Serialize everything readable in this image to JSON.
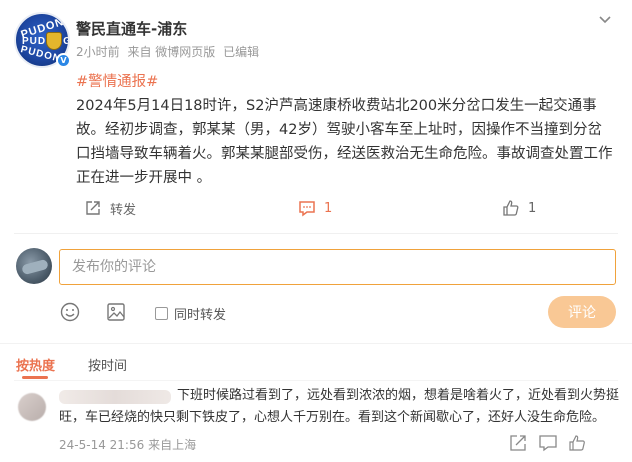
{
  "post": {
    "author_name": "警民直通车-浦东",
    "time": "2小时前",
    "source": "来自 微博网页版",
    "edited": "已编辑",
    "hashtag": "#警情通报#",
    "body": "2024年5月14日18时许，S2沪芦高速康桥收费站北200米分岔口发生一起交通事故。经初步调查，郭某某（男，42岁）驾驶小客车至上址时，因操作不当撞到分岔口挡墙导致车辆着火。郭某某腿部受伤，经送医救治无生命危险。事故调查处置工作正在进一步开展中 。",
    "avatar_text": [
      "PUDONG",
      "PUDONG",
      "PUDONG"
    ]
  },
  "actions": {
    "share_label": "转发",
    "comment_count": "1",
    "like_count": "1"
  },
  "composer": {
    "placeholder": "发布你的评论",
    "repost_label": "同时转发",
    "submit_label": "评论"
  },
  "sort": {
    "hot_label": "按热度",
    "time_label": "按时间"
  },
  "comments": [
    {
      "text_line1": "下班时候路过看到了，远处看到浓浓的烟，想着是啥着火了，近处看到火势挺",
      "text_line2": "旺，车已经烧的快只剩下铁皮了，心想人千万别在。看到这个新闻歇心了，还好人没生命危险。",
      "time": "24-5-14 21:56",
      "location": "来自上海"
    }
  ],
  "colors": {
    "accent": "#eb7350",
    "input_border": "#f0a23b",
    "submit_bg": "#f9c895",
    "verified": "#2b87e6"
  }
}
